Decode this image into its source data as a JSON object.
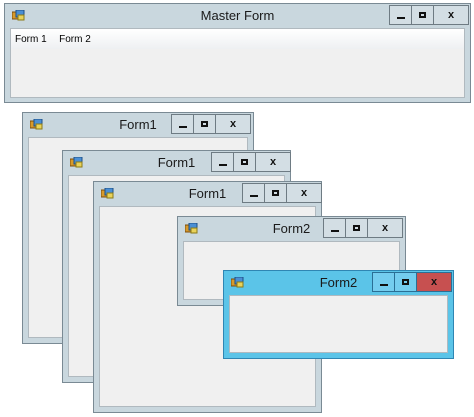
{
  "master": {
    "title": "Master Form",
    "menu": [
      "Form 1",
      "Form 2"
    ]
  },
  "children": [
    {
      "title": "Form1"
    },
    {
      "title": "Form1"
    },
    {
      "title": "Form1"
    },
    {
      "title": "Form2"
    },
    {
      "title": "Form2"
    }
  ],
  "caption": {
    "close_glyph": "x"
  },
  "colors": {
    "inactive_frame": "#c9d7de",
    "active_frame": "#5bc4e8",
    "active_close": "#c75050",
    "client": "#f0f0f0"
  },
  "icons": [
    "app-icon",
    "minimize-icon",
    "maximize-icon",
    "close-icon"
  ]
}
